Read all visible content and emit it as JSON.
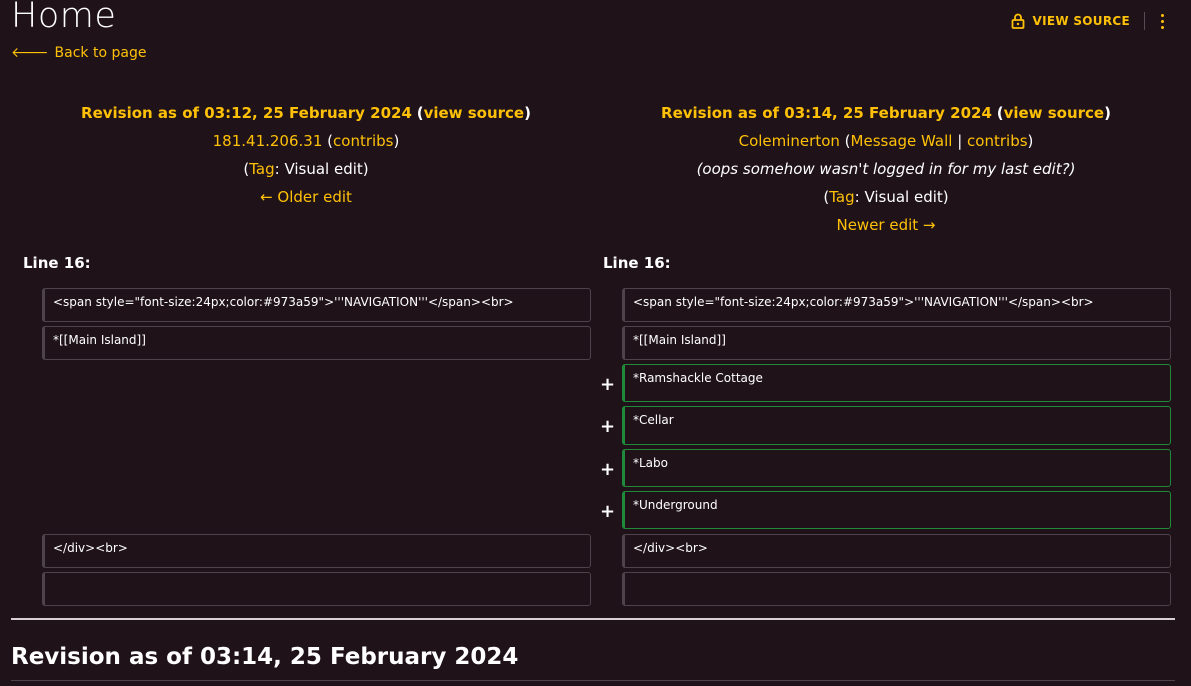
{
  "page": {
    "title": "Home",
    "back_label": "Back to page"
  },
  "toolbar": {
    "view_source_label": "VIEW SOURCE"
  },
  "left_revision": {
    "title": "Revision as of 03:12, 25 February 2024",
    "view_source": "view source",
    "user": "181.41.206.31",
    "contribs": "contribs",
    "tag_label": "Tag",
    "tag_value": "Visual edit",
    "nav": "← Older edit"
  },
  "right_revision": {
    "title": "Revision as of 03:14, 25 February 2024",
    "view_source": "view source",
    "user": "Coleminerton",
    "message_wall": "Message Wall",
    "contribs": "contribs",
    "comment": "(oops somehow wasn't logged in for my last edit?)",
    "tag_label": "Tag",
    "tag_value": "Visual edit",
    "nav": "Newer edit →"
  },
  "diff": {
    "left_line_label": "Line 16:",
    "right_line_label": "Line 16:",
    "left_lines": [
      "<span style=\"font-size:24px;color:#973a59\">'''NAVIGATION'''</span><br>",
      "*[[Main Island]]",
      "</div><br>",
      ""
    ],
    "right_lines": [
      "<span style=\"font-size:24px;color:#973a59\">'''NAVIGATION'''</span><br>",
      "*[[Main Island]]",
      "*Ramshackle Cottage",
      "*Cellar",
      "*Labo",
      "*Underground",
      "</div><br>",
      ""
    ],
    "plus_sign": "+"
  },
  "footer": {
    "heading": "Revision as of 03:14, 25 February 2024"
  },
  "colors": {
    "accent": "#ffc107",
    "background": "#1f1219",
    "added_border": "#1f8a3a"
  }
}
